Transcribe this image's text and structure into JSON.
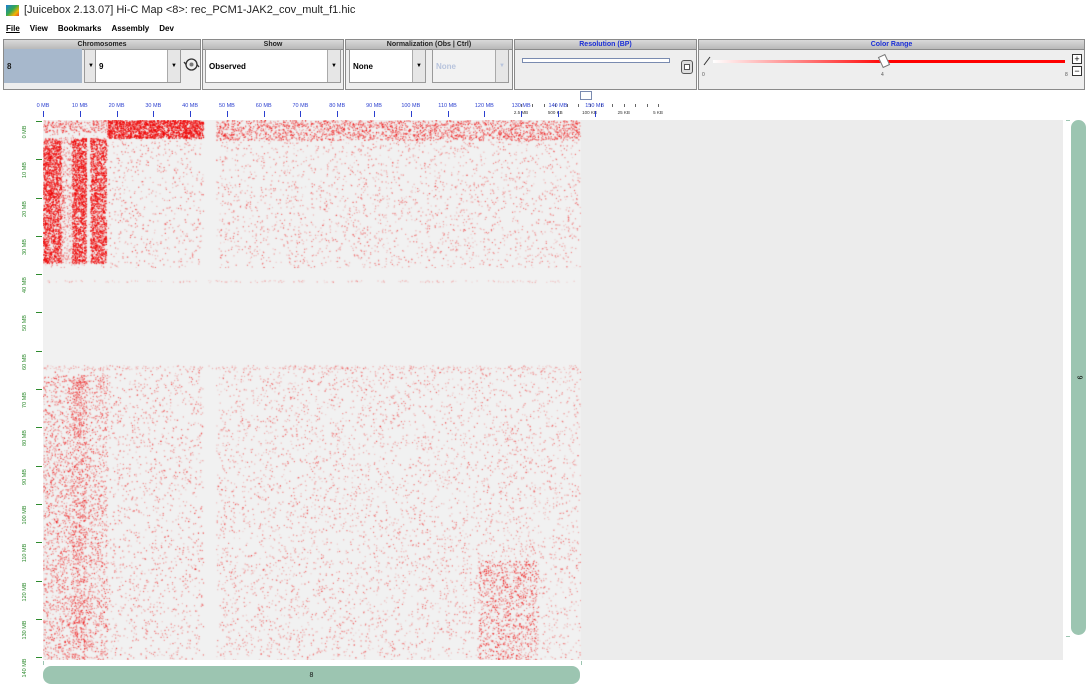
{
  "window": {
    "title": "[Juicebox 2.13.07] Hi-C Map <8>: rec_PCM1-JAK2_cov_mult_f1.hic"
  },
  "menu": [
    "File",
    "View",
    "Bookmarks",
    "Assembly",
    "Dev"
  ],
  "toolbar": {
    "chromosomes": {
      "header": "Chromosomes",
      "chrom1": "8",
      "chrom2": "9"
    },
    "show": {
      "header": "Show",
      "value": "Observed"
    },
    "normalization": {
      "header": "Normalization (Obs | Ctrl)",
      "obs": "None",
      "ctrl": "None"
    },
    "resolution": {
      "header": "Resolution (BP)",
      "labels": [
        "2.5 MB",
        "500 KB",
        "100 KB",
        "25 KB",
        "5 KB"
      ],
      "selected_fraction": 0.43
    },
    "color_range": {
      "header": "Color Range",
      "min": "0",
      "mid": "4",
      "max": "8",
      "plus": "+",
      "minus": "−",
      "level": 0.5
    },
    "colors": {
      "accent": "#ff0000",
      "chrom_bar": "#9cc5b1",
      "map_bg": "#ececec"
    }
  },
  "map": {
    "x_axis_labels": [
      "0 MB",
      "10 MB",
      "20 MB",
      "30 MB",
      "40 MB",
      "50 MB",
      "60 MB",
      "70 MB",
      "80 MB",
      "90 MB",
      "100 MB",
      "110 MB",
      "120 MB",
      "130 MB",
      "140 MB",
      "150 MB"
    ],
    "y_axis_labels": [
      "0 MB",
      "10 MB",
      "20 MB",
      "30 MB",
      "40 MB",
      "50 MB",
      "60 MB",
      "70 MB",
      "80 MB",
      "90 MB",
      "100 MB",
      "110 MB",
      "120 MB",
      "130 MB",
      "140 MB"
    ],
    "x_chrom": "8",
    "y_chrom": "9"
  }
}
